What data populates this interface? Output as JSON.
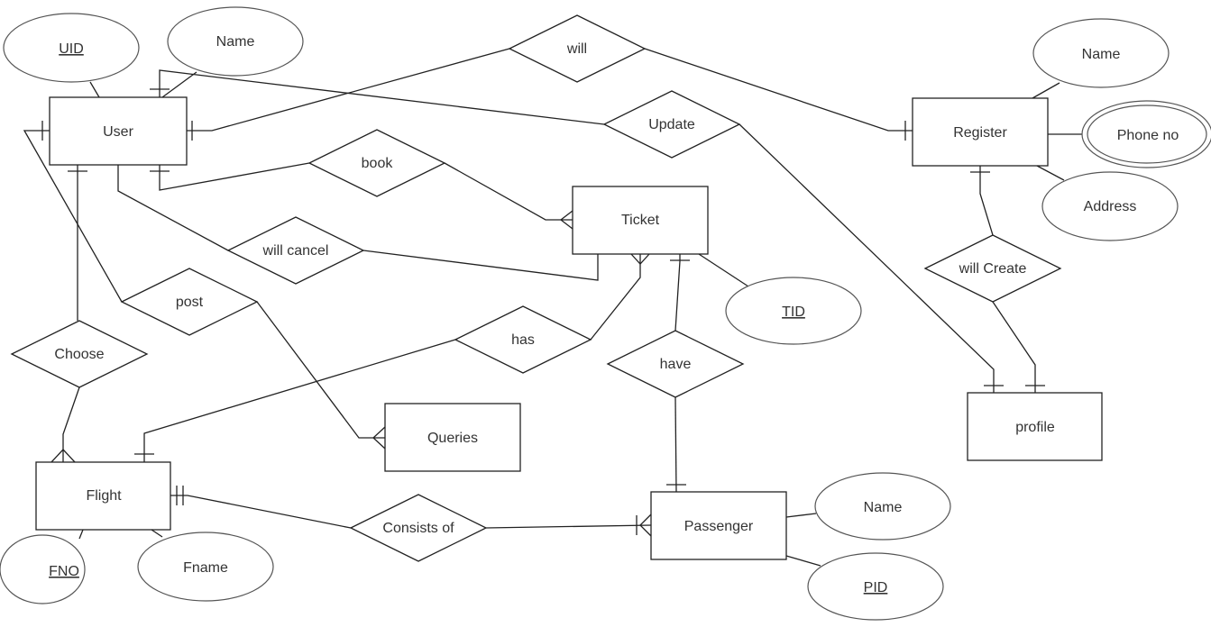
{
  "entities": {
    "user": "User",
    "register": "Register",
    "ticket": "Ticket",
    "profile": "profile",
    "queries": "Queries",
    "flight": "Flight",
    "passenger": "Passenger"
  },
  "attributes": {
    "uid": {
      "label": "UID",
      "key": true
    },
    "user_name": {
      "label": "Name",
      "key": false
    },
    "register_name": {
      "label": "Name",
      "key": false
    },
    "phone_no": {
      "label": "Phone no",
      "multivalued": true
    },
    "address": {
      "label": "Address",
      "key": false
    },
    "tid": {
      "label": "TID",
      "key": true
    },
    "fno": {
      "label": "FNO",
      "key": true
    },
    "fname": {
      "label": "Fname",
      "key": false
    },
    "passenger_name": {
      "label": "Name",
      "key": false
    },
    "pid": {
      "label": "PID",
      "key": true
    }
  },
  "relationships": {
    "will": "will",
    "update": "Update",
    "book": "book",
    "will_cancel": "will cancel",
    "will_create": "will Create",
    "post": "post",
    "has": "has",
    "have": "have",
    "choose": "Choose",
    "consists_of": "Consists of"
  }
}
